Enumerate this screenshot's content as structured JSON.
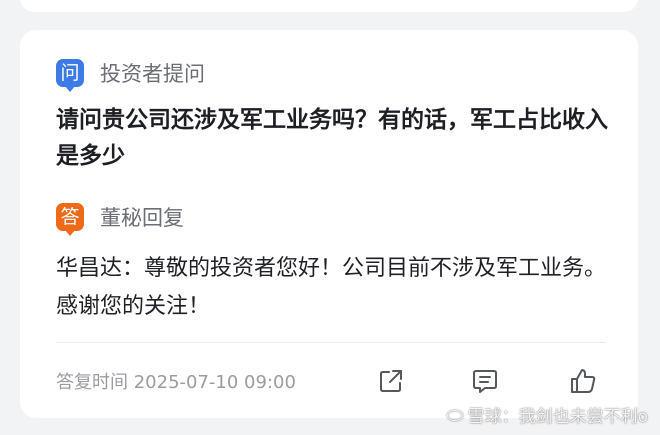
{
  "question_section": {
    "tag_char": "问",
    "label": "投资者提问",
    "text": "请问贵公司还涉及军工业务吗？有的话，军工占比收入是多少"
  },
  "answer_section": {
    "tag_char": "答",
    "label": "董秘回复",
    "text": "华昌达：尊敬的投资者您好！公司目前不涉及军工业务。感谢您的关注！"
  },
  "footer": {
    "reply_time": "答复时间 2025-07-10 09:00"
  },
  "icons": {
    "share": "share-icon",
    "comment": "comment-icon",
    "like": "thumbs-up-icon"
  },
  "watermark": {
    "logo": "⬭",
    "text": "雪球：我剑也未尝不利o"
  },
  "colors": {
    "question_tag": "#3c7ae6",
    "answer_tag": "#ef6a16",
    "background": "#f2f3f5"
  }
}
